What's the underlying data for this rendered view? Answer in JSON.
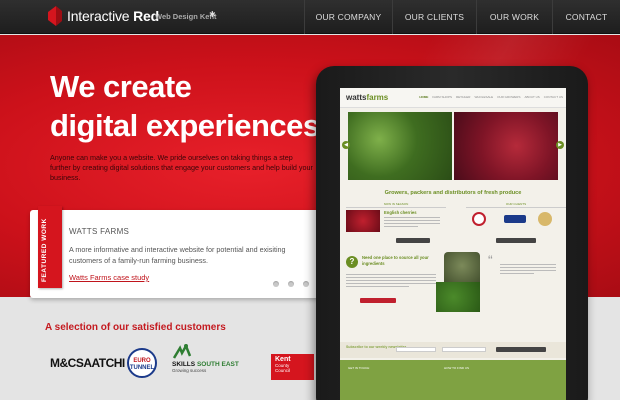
{
  "brand": {
    "name_light": "Interactive ",
    "name_bold": "Red",
    "tagline": "Web Design Kent",
    "accent": "#d5151e"
  },
  "nav": {
    "items": [
      "OUR COMPANY",
      "OUR CLIENTS",
      "OUR WORK",
      "CONTACT"
    ]
  },
  "hero": {
    "headline_line1": "We create",
    "headline_line2": "digital experiences",
    "intro": "Anyone can make you a website. We pride ourselves on taking things a step further by creating digital solutions that engage your customers and help build your business."
  },
  "featured": {
    "ribbon": "FEATURED WORK",
    "title": "WATTS FARMS",
    "text": "A more informative and interactive website for potential and exisiting customers of a family-run farming business.",
    "link": "Watts Farms case study",
    "slides_total": 4,
    "active_slide": 4
  },
  "customers": {
    "title": "A selection of our satisfied customers",
    "logos": {
      "mcsaatchi": "M&CSAATCHI",
      "eurotunnel_1": "EURO",
      "eurotunnel_2": "TUNNEL",
      "skills": "SKILLS",
      "skills_region": "SOUTH EAST",
      "skills_sub": "Growing success",
      "kent_1": "Kent",
      "kent_2": "County",
      "kent_3": "Council"
    }
  },
  "tablet_site": {
    "logo_a": "watts",
    "logo_b": "farms",
    "nav": [
      "HOME",
      "FARM SHOPS",
      "RETAILER",
      "WHOLESALE",
      "OUR GROWERS",
      "ABOUT US",
      "CONTACT US"
    ],
    "tagline": "Growers, packers and distributors of fresh produce",
    "box_left_head": "NOW IN SEASON",
    "box_right_head": "OUR CLIENTS",
    "cherries": "English cherries",
    "question": "Need one place to source all your ingredients",
    "newsletter": "Subscribe to our weekly newsletter",
    "footer_left": "GET IN TOUCH",
    "footer_right": "HOW TO FIND US"
  }
}
